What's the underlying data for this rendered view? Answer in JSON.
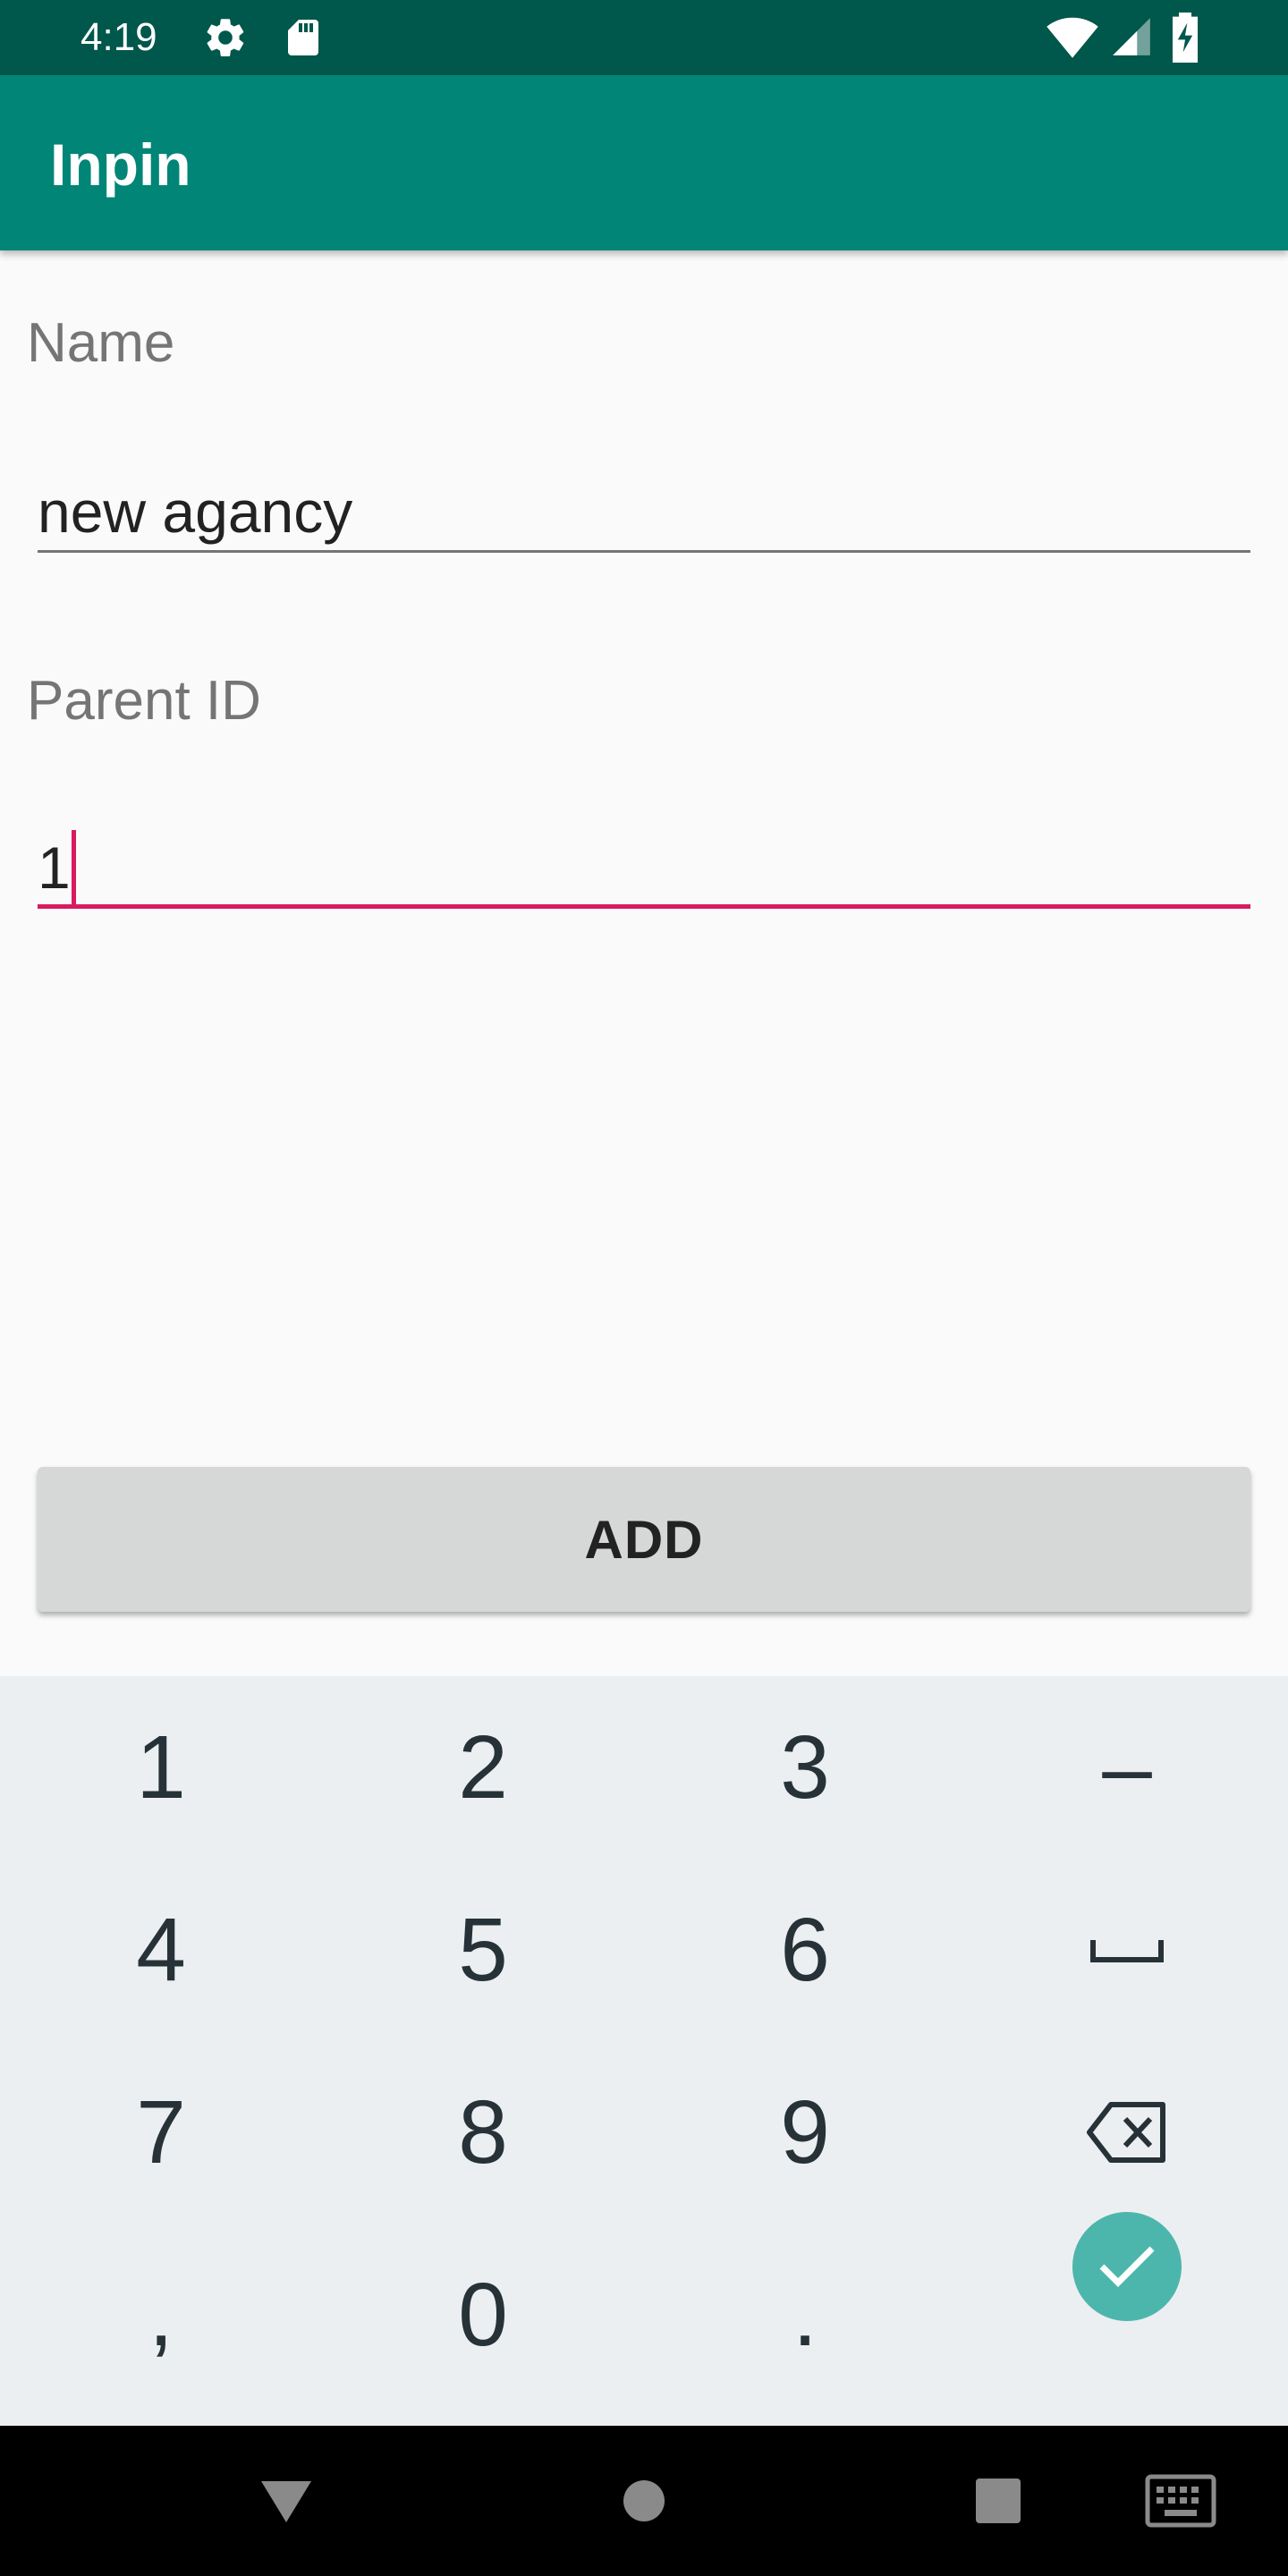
{
  "status_bar": {
    "time": "4:19",
    "icons": [
      "gear-icon",
      "sd-card-icon",
      "wifi-icon",
      "signal-icon",
      "battery-charging-icon"
    ]
  },
  "app_bar": {
    "title": "Inpin",
    "color": "#008577"
  },
  "form": {
    "name_label": "Name",
    "name_value": "new agancy",
    "parent_label": "Parent ID",
    "parent_value": "1",
    "accent_color": "#d81b60"
  },
  "add_button": {
    "label": "ADD"
  },
  "keyboard": {
    "rows": [
      [
        "1",
        "2",
        "3",
        "–"
      ],
      [
        "4",
        "5",
        "6",
        "space-icon"
      ],
      [
        "7",
        "8",
        "9",
        "backspace-icon"
      ],
      [
        ",",
        "0",
        ".",
        "done-icon"
      ]
    ],
    "keys": {
      "k1": "1",
      "k2": "2",
      "k3": "3",
      "dash": "–",
      "k4": "4",
      "k5": "5",
      "k6": "6",
      "k7": "7",
      "k8": "8",
      "k9": "9",
      "comma": ",",
      "k0": "0",
      "period": "."
    },
    "done_color": "#4db6ac"
  },
  "nav_bar": {
    "icons": [
      "back-icon",
      "home-icon",
      "recents-icon",
      "keyboard-switch-icon"
    ]
  }
}
